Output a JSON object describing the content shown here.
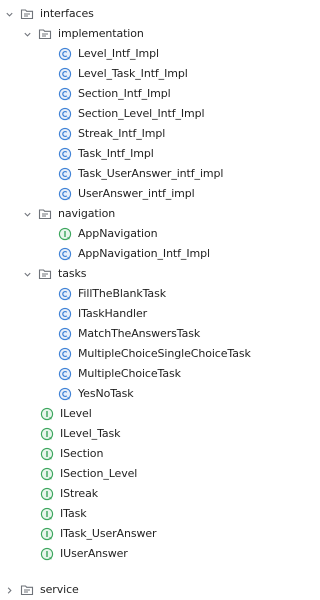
{
  "colors": {
    "class_blue": "#3f82d6",
    "class_fill": "#e8f0fb",
    "interface_green": "#3ba55c",
    "interface_fill": "#e7f5ec",
    "folder_stroke": "#6f737a",
    "chevron": "#6f737a"
  },
  "tree": {
    "interfaces": {
      "label": "interfaces",
      "implementation": {
        "label": "implementation",
        "items": [
          {
            "label": "Level_Intf_Impl",
            "icon": "class-icon"
          },
          {
            "label": "Level_Task_Intf_Impl",
            "icon": "class-icon"
          },
          {
            "label": "Section_Intf_Impl",
            "icon": "class-icon"
          },
          {
            "label": "Section_Level_Intf_Impl",
            "icon": "class-icon"
          },
          {
            "label": "Streak_Intf_Impl",
            "icon": "class-icon"
          },
          {
            "label": "Task_Intf_Impl",
            "icon": "class-icon"
          },
          {
            "label": "Task_UserAnswer_intf_impl",
            "icon": "class-icon"
          },
          {
            "label": "UserAnswer_intf_impl",
            "icon": "class-icon"
          }
        ]
      },
      "navigation": {
        "label": "navigation",
        "items": [
          {
            "label": "AppNavigation",
            "icon": "interface-icon"
          },
          {
            "label": "AppNavigation_Intf_Impl",
            "icon": "class-icon"
          }
        ]
      },
      "tasks": {
        "label": "tasks",
        "items": [
          {
            "label": "FillTheBlankTask",
            "icon": "class-icon"
          },
          {
            "label": "ITaskHandler",
            "icon": "class-icon"
          },
          {
            "label": "MatchTheAnswersTask",
            "icon": "class-icon"
          },
          {
            "label": "MultipleChoiceSingleChoiceTask",
            "icon": "class-icon"
          },
          {
            "label": "MultipleChoiceTask",
            "icon": "class-icon"
          },
          {
            "label": "YesNoTask",
            "icon": "class-icon"
          }
        ]
      },
      "files": [
        {
          "label": "ILevel",
          "icon": "interface-icon"
        },
        {
          "label": "ILevel_Task",
          "icon": "interface-icon"
        },
        {
          "label": "ISection",
          "icon": "interface-icon"
        },
        {
          "label": "ISection_Level",
          "icon": "interface-icon"
        },
        {
          "label": "IStreak",
          "icon": "interface-icon"
        },
        {
          "label": "ITask",
          "icon": "interface-icon"
        },
        {
          "label": "ITask_UserAnswer",
          "icon": "interface-icon"
        },
        {
          "label": "IUserAnswer",
          "icon": "interface-icon"
        }
      ]
    },
    "service": {
      "label": "service"
    }
  }
}
